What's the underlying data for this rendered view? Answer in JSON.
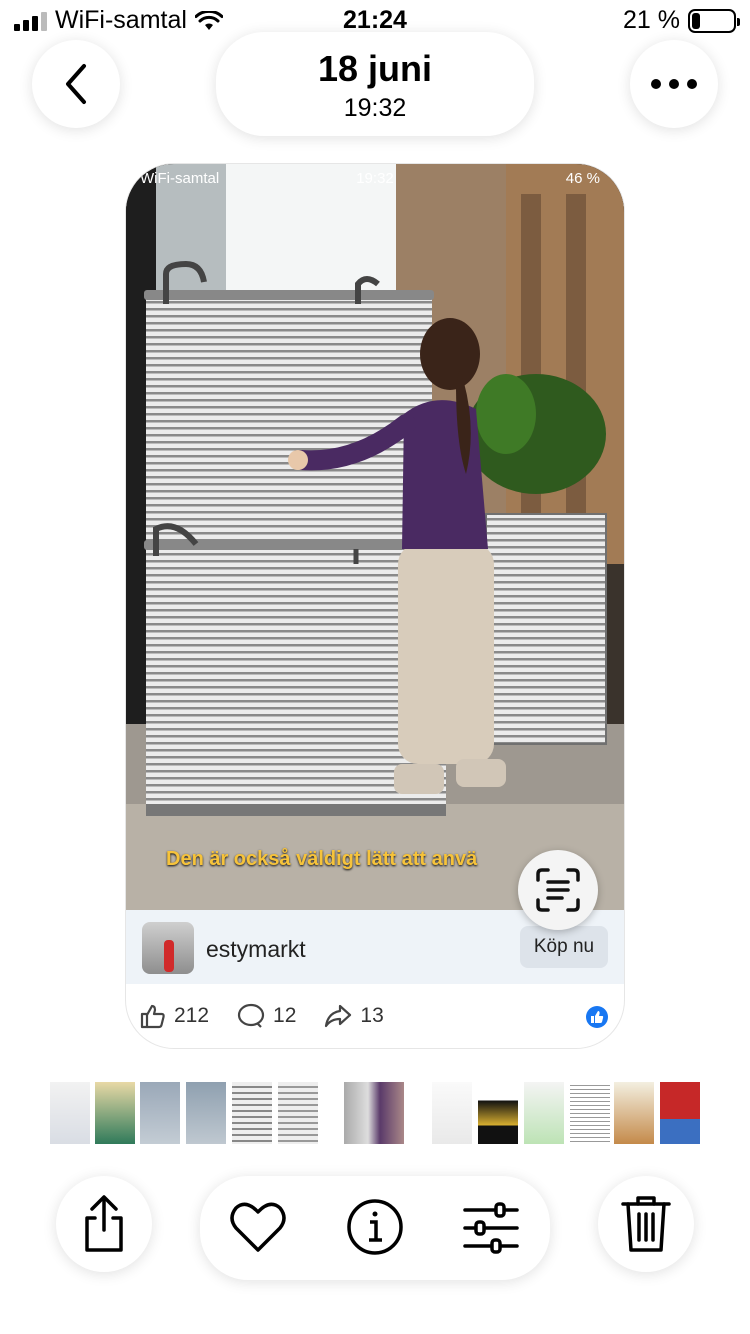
{
  "status_bar": {
    "carrier": "WiFi-samtal",
    "time": "21:24",
    "battery": "21 %",
    "battery_level": 0.21
  },
  "header": {
    "date": "18 juni",
    "time": "19:32",
    "back_icon": "chevron-left-icon",
    "more_icon": "more-icon"
  },
  "photo": {
    "inner_status": {
      "carrier": "WiFi-samtal",
      "time": "19:32",
      "battery": "46 %"
    },
    "subtitle": "Den är också väldigt lätt att anvä",
    "scan_icon": "live-text-icon",
    "ad": {
      "account": "estymarkt",
      "button": "Köp nu"
    },
    "stats": {
      "likes": "212",
      "comments": "12",
      "shares": "13"
    }
  },
  "toolbar": {
    "share_icon": "share-icon",
    "favorite_icon": "heart-icon",
    "info_icon": "info-icon",
    "adjust_icon": "sliders-icon",
    "delete_icon": "trash-icon"
  },
  "colors": {
    "subtitle": "#f6c33b",
    "facebook_blue": "#1877f2",
    "ad_bar": "#eef3f8"
  }
}
